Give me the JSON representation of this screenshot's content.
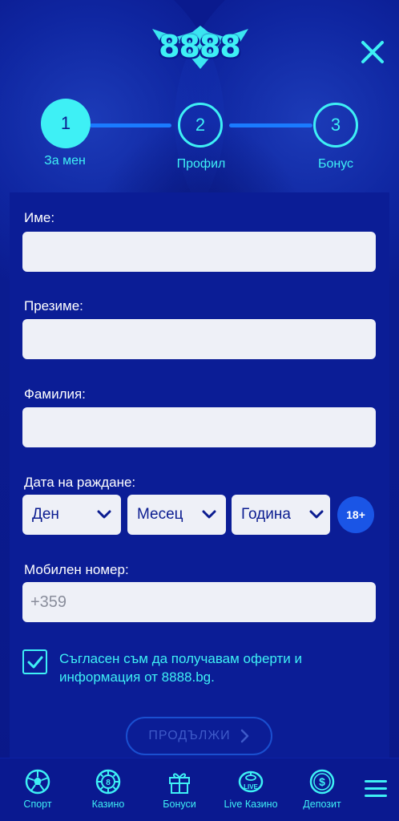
{
  "brand": {
    "logo_text": "8888"
  },
  "stepper": {
    "steps": [
      {
        "number": "1",
        "label": "За мен",
        "active": true
      },
      {
        "number": "2",
        "label": "Профил",
        "active": false
      },
      {
        "number": "3",
        "label": "Бонус",
        "active": false
      }
    ]
  },
  "form": {
    "first_name": {
      "label": "Име:",
      "value": ""
    },
    "middle_name": {
      "label": "Презиме:",
      "value": ""
    },
    "last_name": {
      "label": "Фамилия:",
      "value": ""
    },
    "birth_date": {
      "label": "Дата на раждане:",
      "day": "Ден",
      "month": "Месец",
      "year": "Година",
      "age_badge": "18+"
    },
    "mobile": {
      "label": "Мобилен номер:",
      "placeholder": "+359"
    },
    "consent": {
      "checked": true,
      "text": "Съгласен съм да получавам оферти и информация от 8888.bg."
    },
    "continue_label": "ПРОДЪЛЖИ"
  },
  "bottom_nav": {
    "items": [
      {
        "label": "Спорт",
        "icon": "soccer-ball-icon"
      },
      {
        "label": "Казино",
        "icon": "casino-chip-icon"
      },
      {
        "label": "Бонуси",
        "icon": "gift-icon"
      },
      {
        "label": "Live Казино",
        "icon": "live-casino-icon"
      },
      {
        "label": "Депозит",
        "icon": "deposit-coin-icon"
      }
    ],
    "menu_icon": "hamburger-menu-icon"
  },
  "colors": {
    "background": "#0b1c90",
    "accent_cyan": "#3ef0f5",
    "line_blue": "#1a7bff",
    "badge_blue": "#1a55e6",
    "input_bg": "#eef0f7",
    "text_dark_blue": "#0b1c90"
  }
}
